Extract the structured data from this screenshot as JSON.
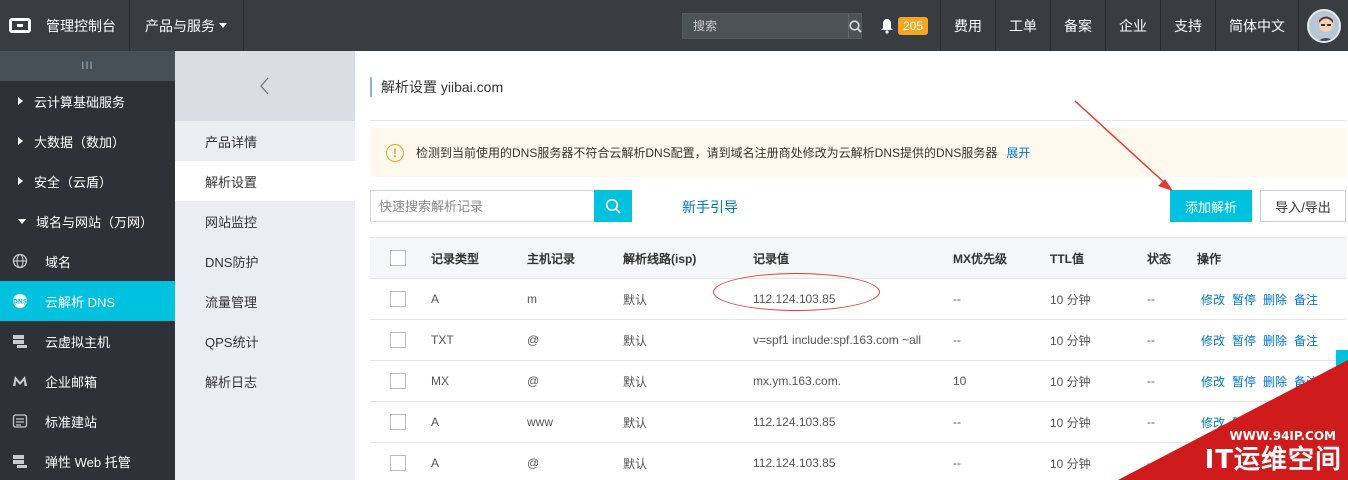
{
  "topbar": {
    "console_label": "管理控制台",
    "products_label": "产品与服务",
    "search_placeholder": "搜索",
    "notification_count": "205",
    "links": [
      "费用",
      "工单",
      "备案",
      "企业",
      "支持",
      "简体中文"
    ]
  },
  "leftnav": {
    "toggle": "III",
    "groups": [
      "云计算基础服务",
      "大数据（数加）",
      "安全（云盾）",
      "域名与网站（万网）"
    ],
    "items": [
      {
        "label": "域名",
        "icon": "globe-icon"
      },
      {
        "label": "云解析 DNS",
        "icon": "dns-icon"
      },
      {
        "label": "云虚拟主机",
        "icon": "server-icon"
      },
      {
        "label": "企业邮箱",
        "icon": "mail-icon"
      },
      {
        "label": "标准建站",
        "icon": "website-icon"
      },
      {
        "label": "弹性 Web 托管",
        "icon": "hosting-icon"
      }
    ]
  },
  "subnav": {
    "items": [
      "产品详情",
      "解析设置",
      "网站监控",
      "DNS防护",
      "流量管理",
      "QPS统计",
      "解析日志"
    ]
  },
  "main": {
    "title": "解析设置 yiibai.com",
    "notice_text": "检测到当前使用的DNS服务器不符合云解析DNS配置，请到域名注册商处修改为云解析DNS提供的DNS服务器",
    "notice_link": "展开",
    "search_placeholder": "快速搜索解析记录",
    "guide_link": "新手引导",
    "add_button": "添加解析",
    "import_button": "导入/导出"
  },
  "table": {
    "headers": [
      "记录类型",
      "主机记录",
      "解析线路(isp)",
      "记录值",
      "MX优先级",
      "TTL值",
      "状态",
      "操作"
    ],
    "ops": [
      "修改",
      "暂停",
      "删除",
      "备注"
    ],
    "rows": [
      {
        "type": "A",
        "host": "m",
        "line": "默认",
        "value": "112.124.103.85",
        "mx": "--",
        "ttl": "10 分钟",
        "status": "--"
      },
      {
        "type": "TXT",
        "host": "@",
        "line": "默认",
        "value": "v=spf1 include:spf.163.com ~all",
        "mx": "--",
        "ttl": "10 分钟",
        "status": "--"
      },
      {
        "type": "MX",
        "host": "@",
        "line": "默认",
        "value": "mx.ym.163.com.",
        "mx": "10",
        "ttl": "10 分钟",
        "status": "--"
      },
      {
        "type": "A",
        "host": "www",
        "line": "默认",
        "value": "112.124.103.85",
        "mx": "--",
        "ttl": "10 分钟",
        "status": "--"
      },
      {
        "type": "A",
        "host": "@",
        "line": "默认",
        "value": "112.124.103.85",
        "mx": "--",
        "ttl": "10 分钟",
        "status": "--"
      }
    ]
  },
  "watermark": {
    "url": "WWW.94IP.COM",
    "text": "IT运维空间"
  },
  "colors": {
    "topbar": "#373d41",
    "accent": "#00c1de",
    "link": "#0077cc",
    "annotation": "#e53935"
  }
}
